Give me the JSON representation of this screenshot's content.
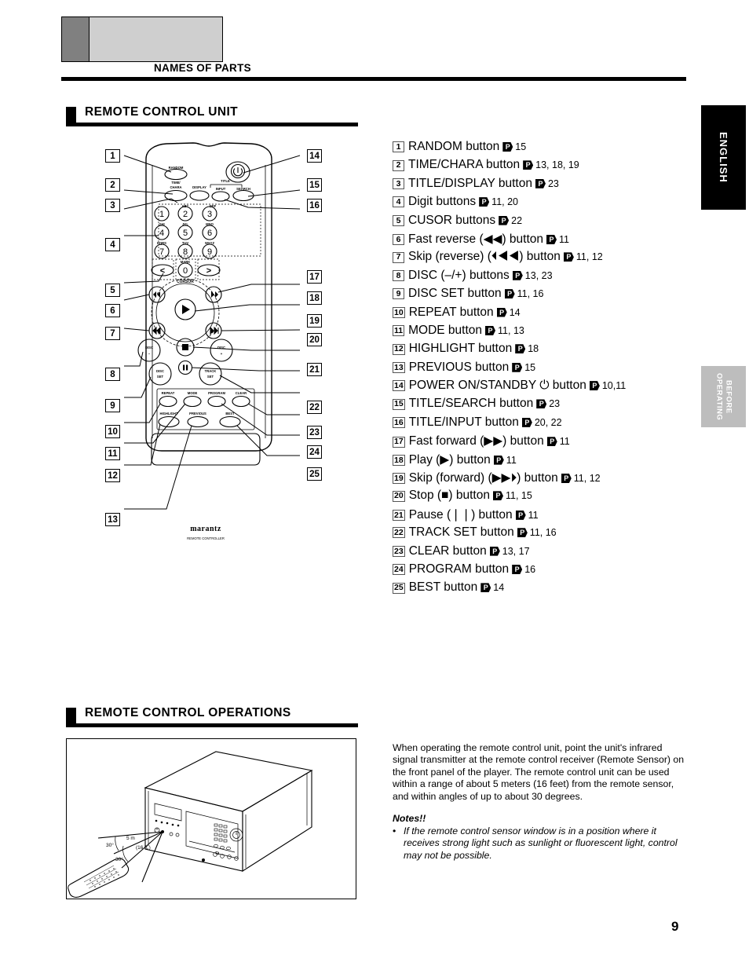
{
  "header": {
    "chapter_title": "NAMES OF PARTS"
  },
  "side_tabs": {
    "english": "ENGLISH",
    "before_operating": "BEFORE\nOPERATING",
    "before_operating_line1": "BEFORE",
    "before_operating_line2": "OPERATING"
  },
  "sections": {
    "remote_control_unit": "REMOTE CONTROL UNIT",
    "remote_control_operations": "REMOTE CONTROL OPERATIONS"
  },
  "parts_list": [
    {
      "num": "1",
      "label": "RANDOM button",
      "pages": "15"
    },
    {
      "num": "2",
      "label": "TIME/CHARA button",
      "pages": "13, 18, 19"
    },
    {
      "num": "3",
      "label": "TITLE/DISPLAY button",
      "pages": "23"
    },
    {
      "num": "4",
      "label": "Digit buttons",
      "pages": "11, 20"
    },
    {
      "num": "5",
      "label": "CUSOR buttons",
      "pages": "22"
    },
    {
      "num": "6",
      "label": "Fast reverse (◀◀) button",
      "pages": "11"
    },
    {
      "num": "7",
      "label": "Skip (reverse) (⏴◀◀) button",
      "pages": "11, 12"
    },
    {
      "num": "8",
      "label": "DISC (–/+) buttons",
      "pages": "13, 23"
    },
    {
      "num": "9",
      "label": "DISC SET button",
      "pages": "11, 16"
    },
    {
      "num": "10",
      "label": "REPEAT button",
      "pages": "14"
    },
    {
      "num": "11",
      "label": "MODE button",
      "pages": "11, 13"
    },
    {
      "num": "12",
      "label": "HIGHLIGHT button",
      "pages": "18"
    },
    {
      "num": "13",
      "label": "PREVIOUS button",
      "pages": "15"
    },
    {
      "num": "14",
      "label": "POWER ON/STANDBY ⏻ button",
      "pages": "10,11"
    },
    {
      "num": "15",
      "label": "TITLE/SEARCH button",
      "pages": "23"
    },
    {
      "num": "16",
      "label": "TITLE/INPUT button",
      "pages": "20, 22"
    },
    {
      "num": "17",
      "label": "Fast forward (▶▶) button",
      "pages": "11"
    },
    {
      "num": "18",
      "label": "Play (▶) button",
      "pages": "11"
    },
    {
      "num": "19",
      "label": "Skip (forward) (▶▶⏵) button",
      "pages": "11, 12"
    },
    {
      "num": "20",
      "label": "Stop (■) button",
      "pages": "11, 15"
    },
    {
      "num": "21",
      "label": "Pause (❘❘) button",
      "pages": "11"
    },
    {
      "num": "22",
      "label": "TRACK SET button",
      "pages": "11, 16"
    },
    {
      "num": "23",
      "label": "CLEAR button",
      "pages": "13, 17"
    },
    {
      "num": "24",
      "label": "PROGRAM button",
      "pages": "16"
    },
    {
      "num": "25",
      "label": "BEST button",
      "pages": "14"
    }
  ],
  "remote": {
    "callouts_left": [
      "1",
      "2",
      "3",
      "4",
      "5",
      "6",
      "7",
      "8",
      "9",
      "10",
      "11",
      "12",
      "13"
    ],
    "callouts_right": [
      "14",
      "15",
      "16",
      "17",
      "18",
      "19",
      "20",
      "21",
      "22",
      "23",
      "24",
      "25"
    ],
    "button_labels": {
      "random": "RANDOM",
      "time": "TIME/",
      "chara": "CHARA",
      "display": "DISPLAY",
      "title": "TITLE",
      "input": "INPUT",
      "search": "SEARCH",
      "cursor": "CURSOR",
      "mark": "MARK",
      "disc_minus_l1": "DISC",
      "disc_minus_l2": "–",
      "disc_plus_l1": "DISC",
      "disc_plus_l2": "+",
      "disc_set_l1": "DISC",
      "disc_set_l2": "SET",
      "track_set_l1": "TRACK",
      "track_set_l2": "SET",
      "repeat": "REPEAT",
      "mode": "MODE",
      "program": "PROGRAM",
      "clear": "CLEAR",
      "highlight": "HIGHLIGHT",
      "previous": "PREVIOUS",
      "best": "BEST"
    },
    "digits": [
      "1",
      "2",
      "3",
      "4",
      "5",
      "6",
      "7",
      "8",
      "9",
      "0"
    ],
    "digit_letters": [
      "",
      "ABC",
      "DEF",
      "GHI",
      "JKL",
      "MNO",
      "PQRS",
      "TUV",
      "WXYZ"
    ],
    "cursor_left": "<",
    "cursor_right": ">",
    "brand": "marantz",
    "brand_sub": "REMOTE CONTROLLER"
  },
  "ops_figure": {
    "distance": "5 m",
    "distance_feet": "(16 ft.)",
    "angle_upper": "30°",
    "angle_lower": "30°"
  },
  "ops_text": {
    "paragraph": "When operating the remote control unit, point the unit's infrared signal transmitter at the remote control receiver (Remote Sensor) on the front panel of the player. The remote control unit can be used within a range of about 5 meters (16 feet) from the remote sensor, and within angles of up to about 30 degrees.",
    "notes_title": "Notes!!",
    "notes": [
      "If the remote control sensor window is in a position where it receives strong light such as sunlight or fluorescent light, control may not be possible."
    ]
  },
  "page_number": "9",
  "colors": {
    "ink": "#000000",
    "header_dark_block": "#808080",
    "header_light_block": "#cfcfcf",
    "tab_gray": "#bdbdbd"
  }
}
